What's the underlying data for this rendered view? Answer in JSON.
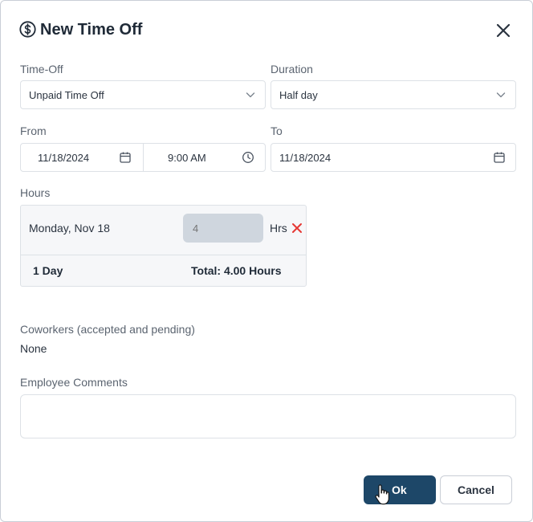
{
  "dialog": {
    "title": "New Time Off",
    "header_icon": "dollar-circle-icon",
    "close_icon": "close-icon"
  },
  "time_off": {
    "label": "Time-Off",
    "value": "Unpaid Time Off"
  },
  "duration": {
    "label": "Duration",
    "value": "Half day"
  },
  "from": {
    "label": "From",
    "date": "11/18/2024",
    "time": "9:00 AM"
  },
  "to": {
    "label": "To",
    "date": "11/18/2024"
  },
  "hours": {
    "label": "Hours",
    "rows": [
      {
        "day": "Monday, Nov 18",
        "hours_placeholder": "4",
        "unit": "Hrs"
      }
    ],
    "days_count": "1 Day",
    "total": "Total: 4.00 Hours"
  },
  "coworkers": {
    "label": "Coworkers (accepted and pending)",
    "value": "None"
  },
  "comments": {
    "label": "Employee Comments",
    "value": ""
  },
  "actions": {
    "ok_label": "Ok",
    "cancel_label": "Cancel"
  },
  "colors": {
    "primary": "#1d4768",
    "remove": "#e53935",
    "border": "#dde1e6"
  }
}
